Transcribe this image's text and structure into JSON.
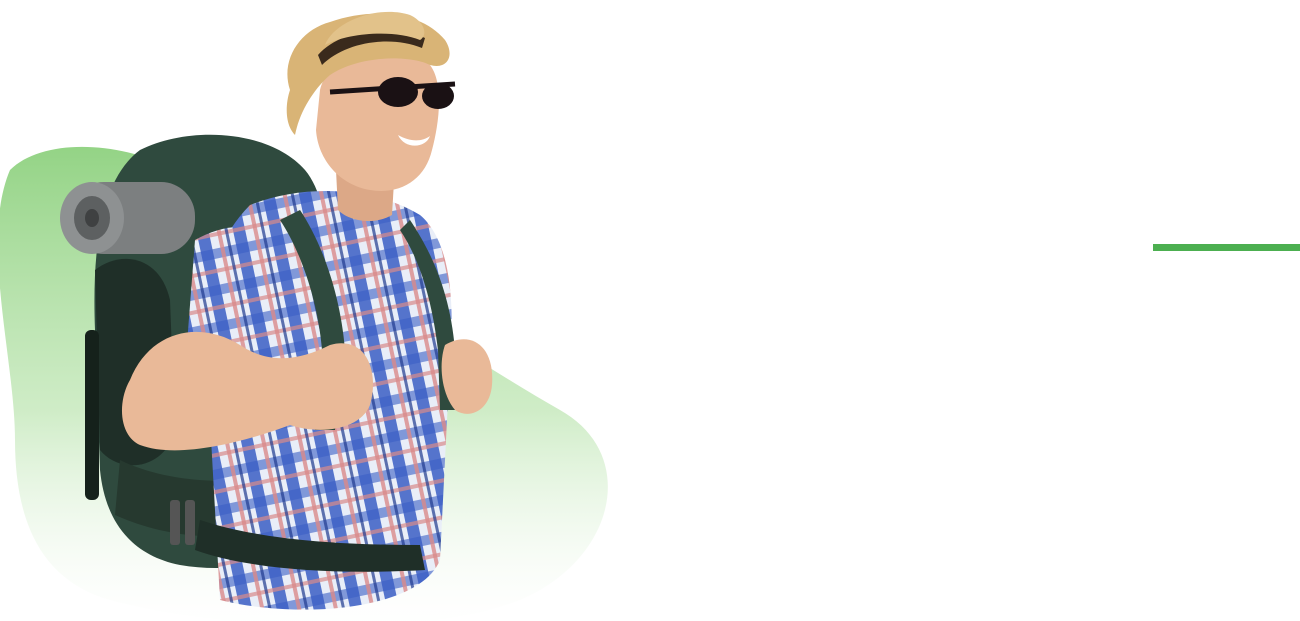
{
  "colors": {
    "accent": "#4caf50",
    "blob_top": "#8ed17f",
    "blob_bottom": "#ffffff",
    "background": "#ffffff",
    "shirt_blue": "#3b5fc4",
    "shirt_light": "#e9eef8",
    "shirt_red": "#d98a8a",
    "backpack": "#2f4a3e",
    "backpack_dark": "#1f2f28",
    "mat": "#7c7f80",
    "hat": "#d9b476",
    "skin": "#e9b998",
    "glasses": "#1a1114"
  },
  "hero": {
    "image_subject": "backpacker-photo"
  }
}
